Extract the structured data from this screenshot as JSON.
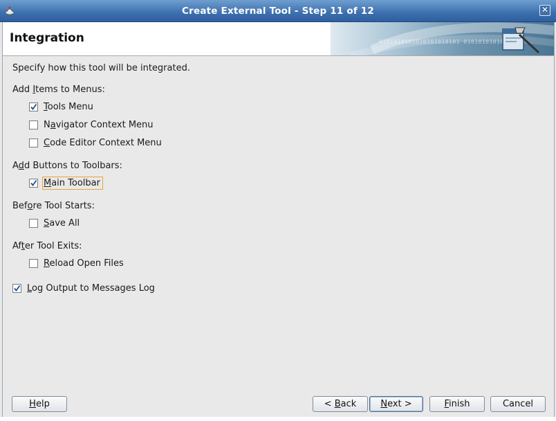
{
  "window": {
    "title": "Create External Tool - Step 11 of 12",
    "close_label": "✕"
  },
  "header": {
    "heading": "Integration",
    "banner_digits": "0101010101010101010101 01010101010"
  },
  "instruction": "Specify how this tool will be integrated.",
  "groups": {
    "menus": {
      "label_pre": "Add ",
      "label_mn": "I",
      "label_post": "tems to Menus:",
      "items": [
        {
          "pre": "",
          "mn": "T",
          "post": "ools Menu",
          "checked": true
        },
        {
          "pre": "N",
          "mn": "a",
          "post": "vigator Context Menu",
          "checked": false
        },
        {
          "pre": "",
          "mn": "C",
          "post": "ode Editor Context Menu",
          "checked": false
        }
      ]
    },
    "toolbars": {
      "label_pre": "A",
      "label_mn": "d",
      "label_post": "d Buttons to Toolbars:",
      "items": [
        {
          "pre": "",
          "mn": "M",
          "post": "ain Toolbar",
          "checked": true
        }
      ]
    },
    "before": {
      "label_pre": "Bef",
      "label_mn": "o",
      "label_post": "re Tool Starts:",
      "items": [
        {
          "pre": "",
          "mn": "S",
          "post": "ave All",
          "checked": false
        }
      ]
    },
    "after": {
      "label_pre": "Af",
      "label_mn": "t",
      "label_post": "er Tool Exits:",
      "items": [
        {
          "pre": "",
          "mn": "R",
          "post": "eload Open Files",
          "checked": false
        }
      ]
    },
    "log": {
      "pre": "",
      "mn": "L",
      "post": "og Output to Messages Log",
      "checked": true
    }
  },
  "buttons": {
    "help": {
      "pre": "",
      "mn": "H",
      "post": "elp"
    },
    "back": {
      "pre": "< ",
      "mn": "B",
      "post": "ack"
    },
    "next": {
      "pre": "",
      "mn": "N",
      "post": "ext >"
    },
    "finish": {
      "pre": "",
      "mn": "F",
      "post": "inish"
    },
    "cancel": {
      "pre": "",
      "mn": "",
      "post": "Cancel"
    }
  },
  "colors": {
    "titlebar": "#3c6fae",
    "focus_border": "#e8a33d",
    "check": "#1c4f8c"
  }
}
